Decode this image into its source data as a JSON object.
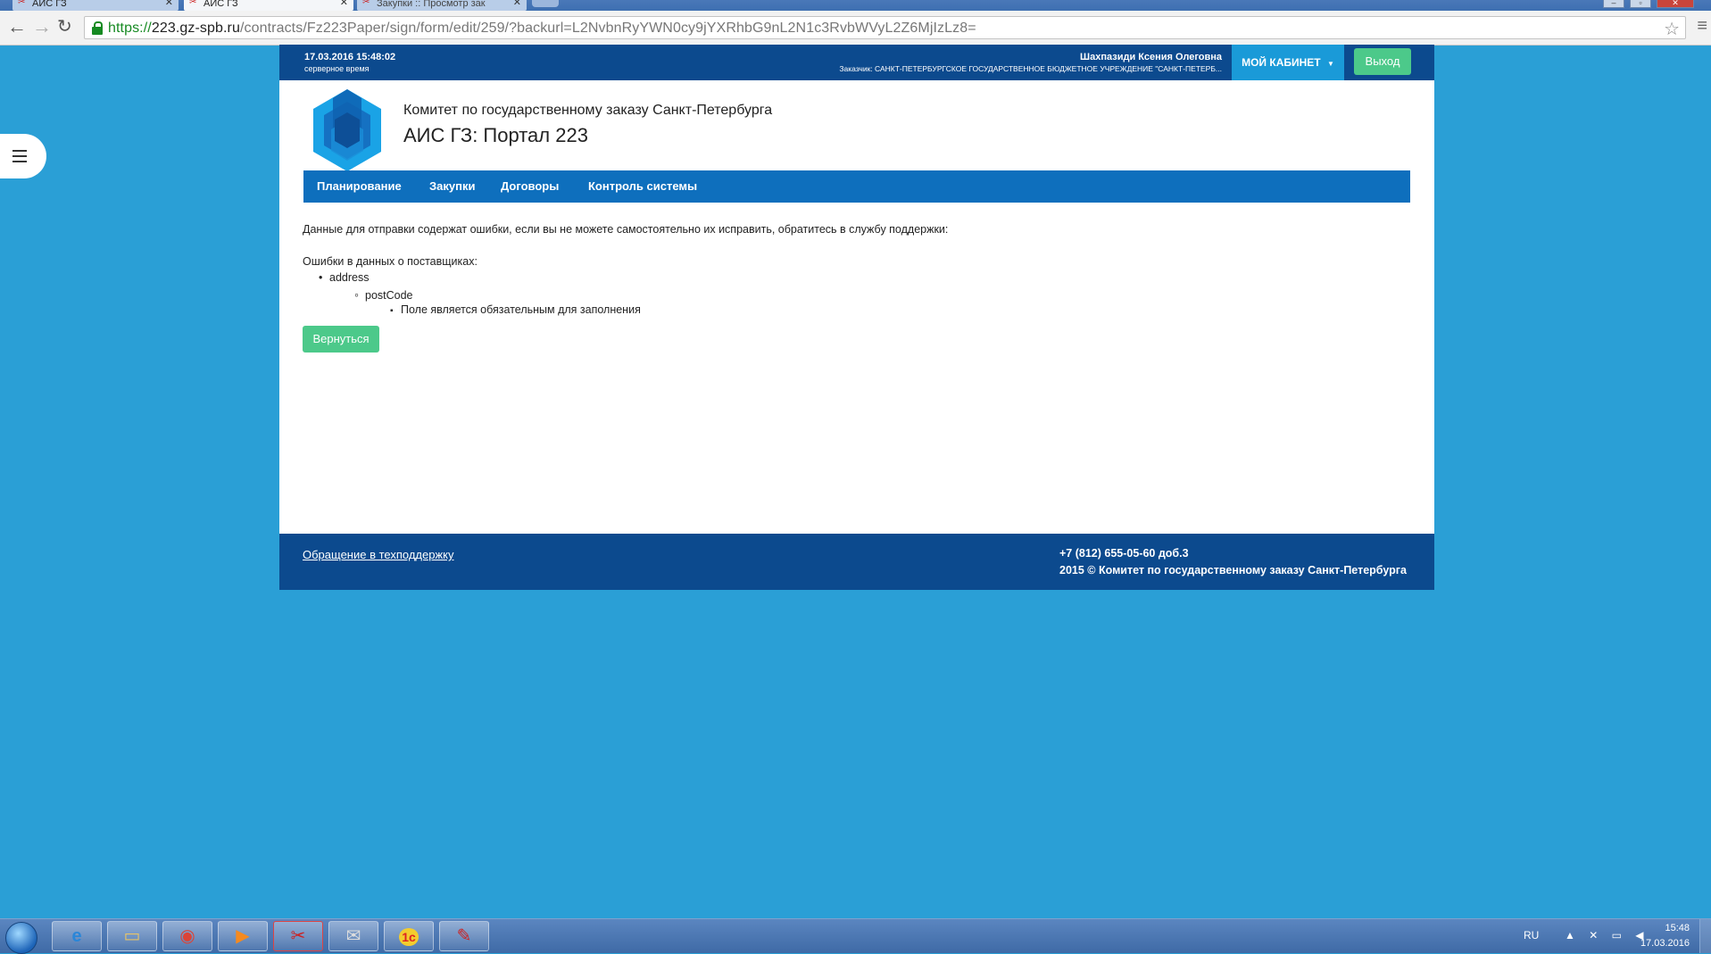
{
  "browser": {
    "tabs": [
      {
        "label": "АИС ГЗ",
        "active": false
      },
      {
        "label": "АИС ГЗ",
        "active": true
      },
      {
        "label": "Закупки :: Просмотр зак",
        "active": false
      }
    ],
    "url_scheme": "https://",
    "url_host": "223.gz-spb.ru",
    "url_path": "/contracts/Fz223Paper/sign/form/edit/259/?backurl=L2NvbnRyYWN0cy9jYXRhbG9nL2N1c3RvbWVyL2Z6MjIzLz8="
  },
  "topbar": {
    "datetime": "17.03.2016 15:48:02",
    "datetime_sub": "серверное время",
    "user_name": "Шахпазиди Ксения Олеговна",
    "customer": "Заказчик: САНКТ-ПЕТЕРБУРГСКОЕ ГОСУДАРСТВЕННОЕ БЮДЖЕТНОЕ УЧРЕЖДЕНИЕ \"САНКТ-ПЕТЕРБ...",
    "cabinet_label": "МОЙ КАБИНЕТ",
    "logout_label": "Выход"
  },
  "header": {
    "org_name": "Комитет по государственному заказу Санкт-Петербурга",
    "portal_name": "АИС ГЗ: Портал 223"
  },
  "nav": {
    "items": [
      {
        "label": "Планирование"
      },
      {
        "label": "Закупки"
      },
      {
        "label": "Договоры"
      },
      {
        "label": "Контроль системы"
      }
    ]
  },
  "main": {
    "message": "Данные для отправки содержат ошибки, если вы не можете самостоятельно их исправить, обратитесь в службу поддержки:",
    "errors_heading": "Ошибки в данных о поставщиках:",
    "error_field": "address",
    "error_subfield": "postCode",
    "error_text": "Поле является обязательным для заполнения",
    "back_label": "Вернуться"
  },
  "footer": {
    "support_link": "Обращение в техподдержку",
    "phone": "+7 (812) 655-05-60 доб.3",
    "copyright": "2015 © Комитет по государственному заказу Санкт-Петербурга"
  },
  "taskbar": {
    "lang": "RU",
    "time": "15:48",
    "date": "17.03.2016"
  },
  "colors": {
    "page_background": "#2a9fd6",
    "header_blue": "#0c4a8e",
    "nav_blue": "#0e6fbd",
    "cabinet_blue": "#1a9ad8",
    "button_green": "#4cc98a"
  }
}
